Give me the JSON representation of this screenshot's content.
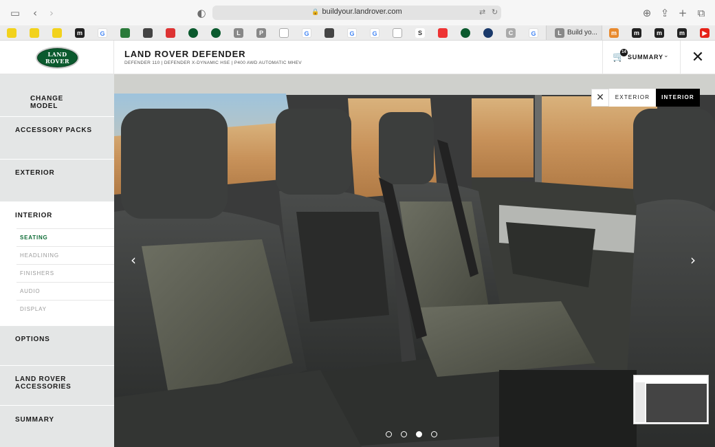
{
  "browser": {
    "url": "buildyour.landrover.com",
    "tab_label": "Build yo..."
  },
  "header": {
    "logo_line1": "LAND",
    "logo_line2": "ROVER",
    "model_title": "LAND ROVER DEFENDER",
    "model_subtitle": "DEFENDER 110 | DEFENDER X-DYNAMIC HSE | P400 AWD AUTOMATIC MHEV",
    "cart_count": "14",
    "summary_label": "SUMMARY"
  },
  "sidebar": {
    "change_model": "CHANGE MODEL",
    "items": [
      {
        "label": "ACCESSORY PACKS"
      },
      {
        "label": "EXTERIOR"
      },
      {
        "label": "INTERIOR"
      },
      {
        "label": "OPTIONS"
      },
      {
        "label": "LAND ROVER\nACCESSORIES"
      },
      {
        "label": "SUMMARY"
      }
    ],
    "interior_sub": [
      {
        "label": "SEATING"
      },
      {
        "label": "HEADLINING"
      },
      {
        "label": "FINISHERS"
      },
      {
        "label": "AUDIO"
      },
      {
        "label": "DISPLAY"
      }
    ]
  },
  "viewer": {
    "toggle_exterior": "EXTERIOR",
    "toggle_interior": "INTERIOR",
    "active_slide": 3,
    "slide_count": 4
  },
  "colors": {
    "brand_green": "#0b5a2e",
    "active_sub": "#0c6b34",
    "sidebar_bg": "#e4e6e6"
  }
}
